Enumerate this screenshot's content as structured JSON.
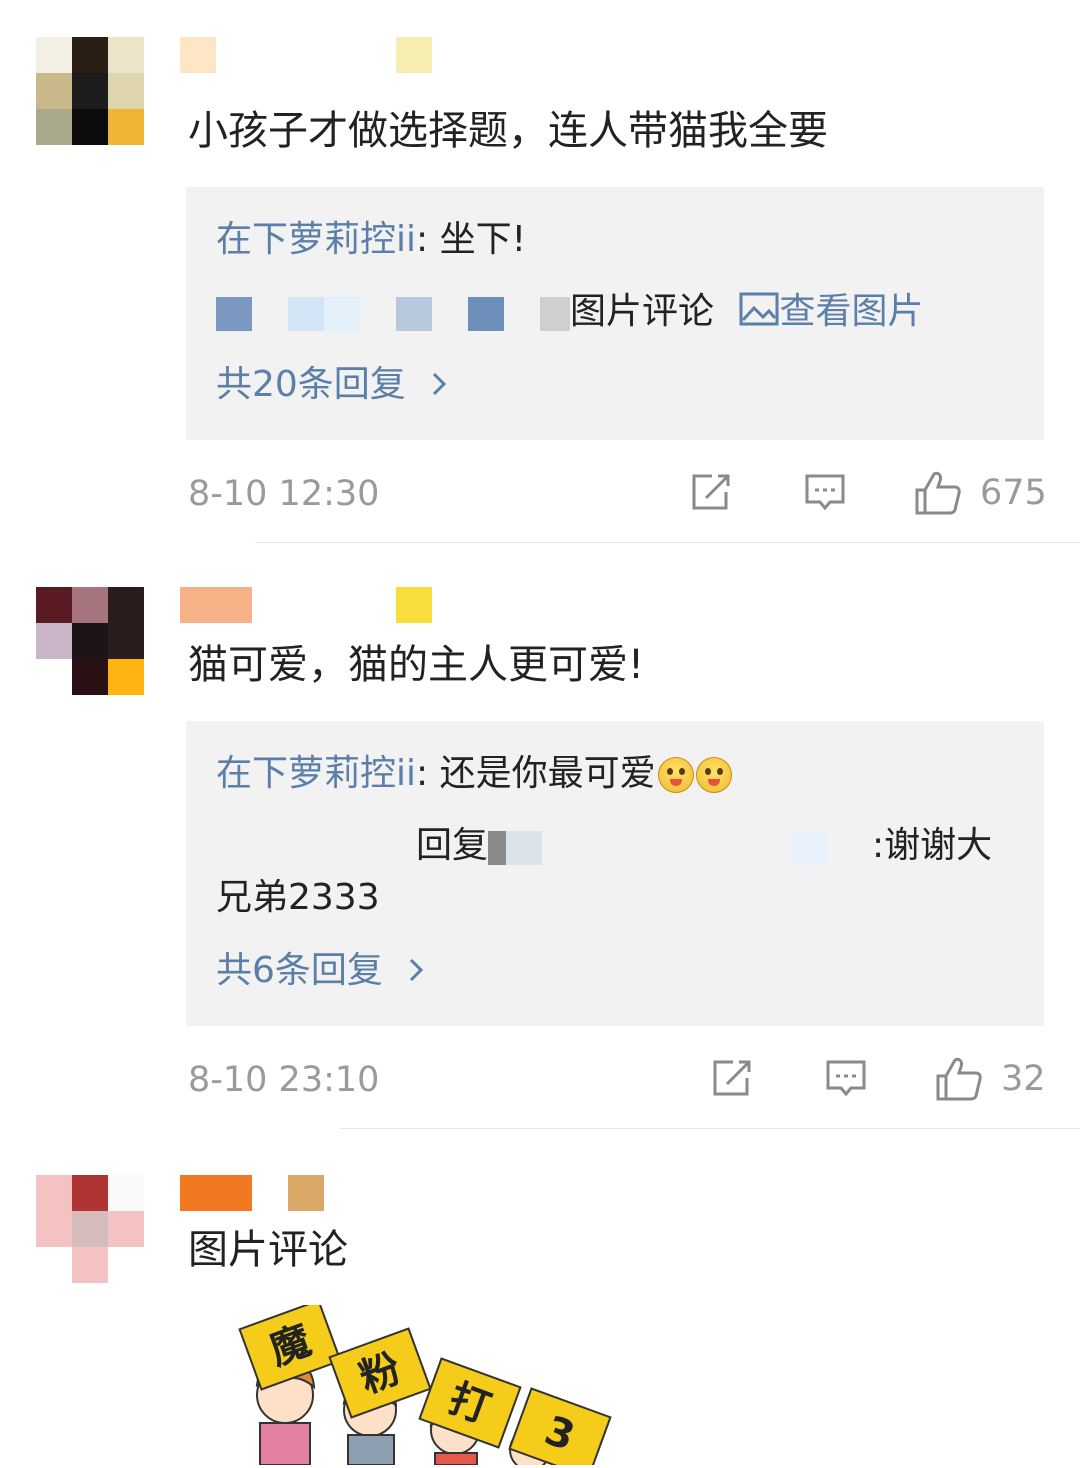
{
  "comments": [
    {
      "text": "小孩子才做选择题，连人带猫我全要",
      "reply_name": "在下萝莉控ii",
      "reply_text": ": 坐下!",
      "second_reply_tail": "图片评论",
      "view_image_label": "查看图片",
      "replies_label": "共20条回复",
      "time": "8-10 12:30",
      "likes": "675"
    },
    {
      "text": "猫可爱，猫的主人更可爱!",
      "reply_name": "在下萝莉控ii",
      "reply_text": ": 还是你最可爱",
      "second_reply_mid": "回复",
      "second_reply_tail": ":谢谢大",
      "second_reply_line2": "兄弟2333",
      "replies_label": "共6条回复",
      "time": "8-10 23:10",
      "likes": "32"
    },
    {
      "text": "图片评论",
      "sign_chars": [
        "魔",
        "粉",
        "打",
        "3"
      ]
    }
  ],
  "colors": {
    "link": "#5b7fa9",
    "reply_bg": "#f2f2f2",
    "meta": "#9a9a9a"
  },
  "icons": [
    "share-icon",
    "comment-icon",
    "like-icon",
    "image-icon",
    "chevron-right-icon",
    "emoji-icon"
  ]
}
